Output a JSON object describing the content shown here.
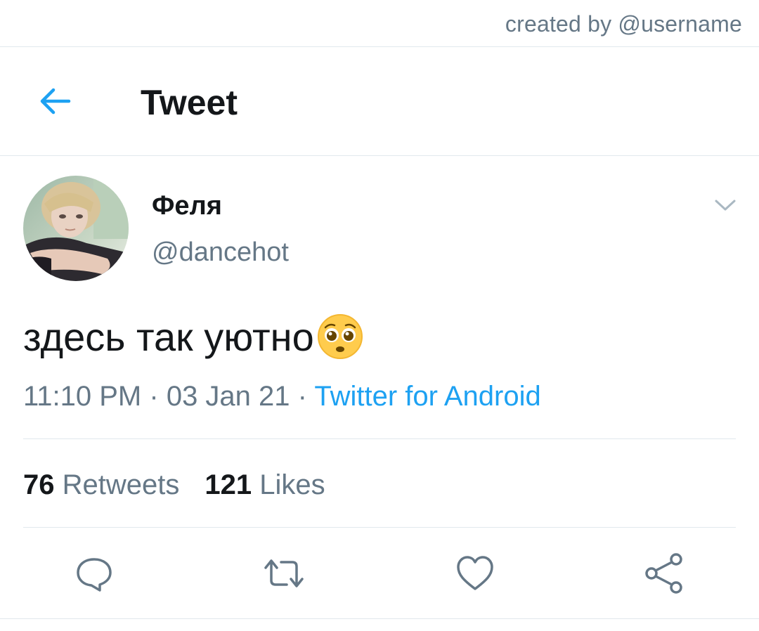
{
  "credit": {
    "text": "created by @username"
  },
  "header": {
    "title": "Tweet",
    "back_icon": "arrow-left-icon"
  },
  "tweet": {
    "author": {
      "display_name": "Феля",
      "handle": "@dancehot"
    },
    "text": "здесь так уютно",
    "emoji": "pleading-face-emoji",
    "time": "11:10 PM",
    "separator": "·",
    "date": "03 Jan 21",
    "source": "Twitter for Android",
    "stats": {
      "retweets_count": "76",
      "retweets_label": "Retweets",
      "likes_count": "121",
      "likes_label": "Likes"
    }
  },
  "actions": [
    "reply-icon",
    "retweet-icon",
    "like-icon",
    "share-icon"
  ],
  "colors": {
    "accent": "#1da1f2",
    "text_primary": "#14171a",
    "text_secondary": "#657786",
    "divider": "#e1e8ed"
  }
}
